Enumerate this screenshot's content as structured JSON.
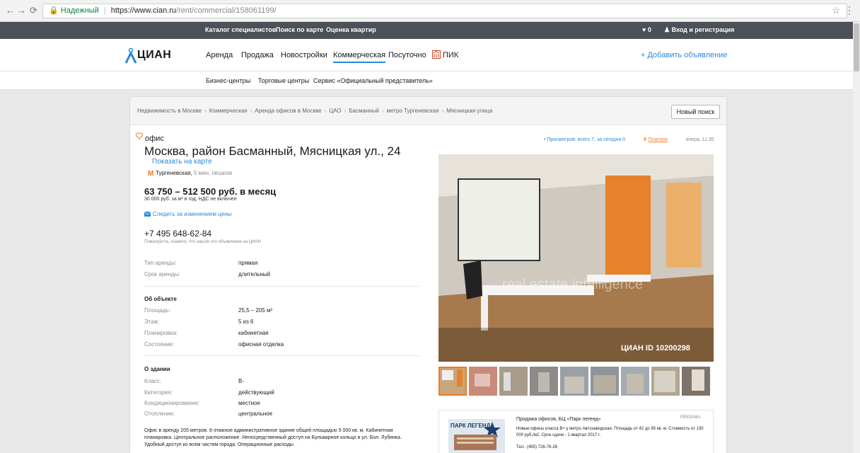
{
  "browser": {
    "secure_label": "Надежный",
    "url_host": "https://www.cian.ru",
    "url_path": "/rent/commercial/158061199/"
  },
  "topbar": {
    "links": [
      "Каталог специалистов",
      "Поиск по карте",
      "Оценка квартир"
    ],
    "favorites_count": "0",
    "login": "Вход и регистрация"
  },
  "mainnav": {
    "logo": "ЦИАН",
    "items": [
      "Аренда",
      "Продажа",
      "Новостройки",
      "Коммерческая",
      "Посуточно",
      "ПИК"
    ],
    "active_item": "Коммерческая",
    "add_listing": "+ Добавить объявление"
  },
  "subnav": {
    "items": [
      "Бизнес-центры",
      "Торговые центры",
      "Сервис «Официальный представитель»"
    ]
  },
  "breadcrumbs": [
    "Недвижимость в Москве",
    "Коммерческая",
    "Аренда офисов в Москве",
    "ЦАО",
    "Басманный",
    "метро Тургеневская",
    "Мясницкая улица"
  ],
  "new_search": "Новый поиск",
  "listing": {
    "type": "офис",
    "address": "Москва, район Басманный, Мясницкая ул., 24",
    "map_link": "Показать на карте",
    "metro_station": "Тургеневская,",
    "metro_distance": "5 мин. пешком",
    "price": "63 750 – 512 500 руб. в месяц",
    "price_note": "30 000 руб. за м² в год, НДС не включен",
    "track_price": "Следить за изменением цены",
    "phone": "+7 495 648-62-84",
    "phone_note": "Пожалуйста, скажите, что нашли это объявление на ЦИАН",
    "views": "• Просмотров: всего 7, за сегодня 0",
    "paid_symbol": "₽",
    "paid_label": "Платное",
    "date": "вчера, 11:35",
    "photo_id": "ЦИАН ID 10200298",
    "watermark": "real estate intelligence",
    "description": "Офис в аренду 205 метров. 6-этажное административное здание общей площадью 5 000 кв. м. Кабинетная планировка. Центральное расположение. Непосредственный доступ на Бульварное кольцо и ул. Бол. Лубянка. Удобный доступ ко всем частям города. Операционные расходы"
  },
  "rent_terms": [
    {
      "label": "Тип аренды:",
      "value": "прямая"
    },
    {
      "label": "Срок аренды:",
      "value": "длительный"
    }
  ],
  "object_section": {
    "title": "Об объекте",
    "rows": [
      {
        "label": "Площадь:",
        "value": "25,5 – 205 м²"
      },
      {
        "label": "Этаж:",
        "value": "5 из 6"
      },
      {
        "label": "Планировка:",
        "value": "кабинетная"
      },
      {
        "label": "Состояние:",
        "value": "офисная отделка"
      }
    ]
  },
  "building_section": {
    "title": "О здании",
    "rows": [
      {
        "label": "Класс:",
        "value": "B-"
      },
      {
        "label": "Категория:",
        "value": "действующий"
      },
      {
        "label": "Кондиционирование:",
        "value": "местное"
      },
      {
        "label": "Отопление:",
        "value": "центральное"
      }
    ]
  },
  "ad": {
    "tag": "РЕКЛАМА",
    "image_title": "ПАРК ЛЕГЕНД",
    "title": "Продажа офисов, БЦ «Парк легенд»",
    "text": "Новые офисы класса B+ у метро Автозаводская. Площадь от 42 до 95 кв. м. Стоимость от 130 000 руб./м2. Срок сдачи - 1 квартал 2017 г.",
    "phone": "Тел.: (495) 726-76-26"
  },
  "colors": {
    "accent": "#2b87db",
    "orange": "#f47a20",
    "topbar": "#4b5059"
  }
}
